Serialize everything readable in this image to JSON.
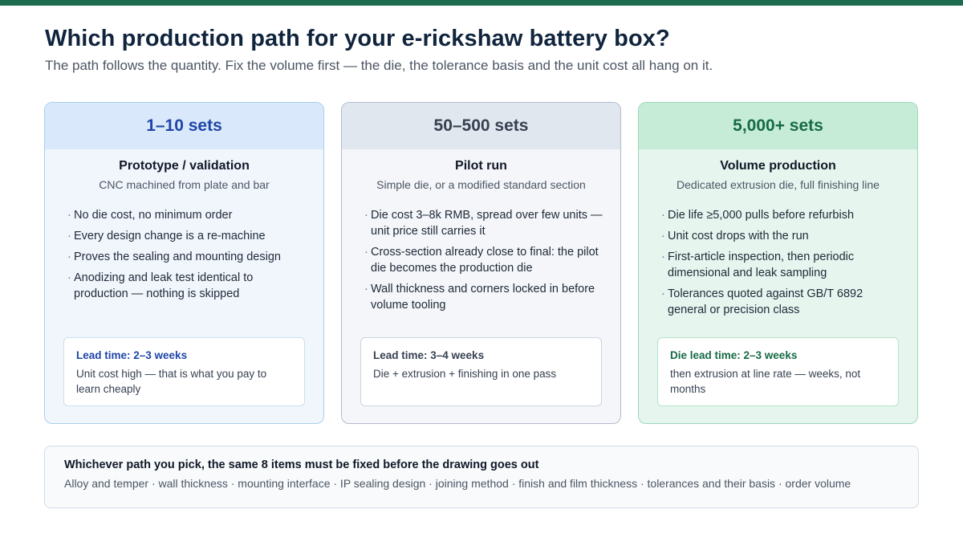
{
  "header": {
    "title": "Which production path for your e-rickshaw battery box?",
    "subtitle": "The path follows the quantity. Fix the volume first — the die, the tolerance basis and the unit cost all hang on it."
  },
  "colors": {
    "top_bar": "#1d6b4e",
    "card1_accent": "#1f45a8",
    "card2_accent": "#374151",
    "card3_accent": "#166a45"
  },
  "cards": [
    {
      "quantity": "1–10 sets",
      "name": "Prototype / validation",
      "description": "CNC machined from plate and bar",
      "bullets": [
        "No die cost, no minimum order",
        "Every design change is a re-machine",
        "Proves the sealing and mounting design",
        "Anodizing and leak test identical to production — nothing is skipped"
      ],
      "lead_title": "Lead time: 2–3 weeks",
      "lead_text": "Unit cost high — that is what you pay to learn cheaply"
    },
    {
      "quantity": "50–500 sets",
      "name": "Pilot run",
      "description": "Simple die, or a modified standard section",
      "bullets": [
        "Die cost 3–8k RMB, spread over few units — unit price still carries it",
        "Cross-section already close to final: the pilot die becomes the production die",
        "Wall thickness and corners locked in before volume tooling"
      ],
      "lead_title": "Lead time: 3–4 weeks",
      "lead_text": "Die + extrusion + finishing in one pass"
    },
    {
      "quantity": "5,000+ sets",
      "name": "Volume production",
      "description": "Dedicated extrusion die, full finishing line",
      "bullets": [
        "Die life ≥5,000 pulls before refurbish",
        "Unit cost drops with the run",
        "First-article inspection, then periodic dimensional and leak sampling",
        "Tolerances quoted against GB/T 6892 general or precision class"
      ],
      "lead_title": "Die lead time: 2–3 weeks",
      "lead_text": "then extrusion at line rate — weeks, not months"
    }
  ],
  "footer": {
    "title": "Whichever path you pick, the same 8 items must be fixed before the drawing goes out",
    "text": "Alloy and temper · wall thickness · mounting interface · IP sealing design · joining method · finish and film thickness · tolerances and their basis · order volume"
  }
}
